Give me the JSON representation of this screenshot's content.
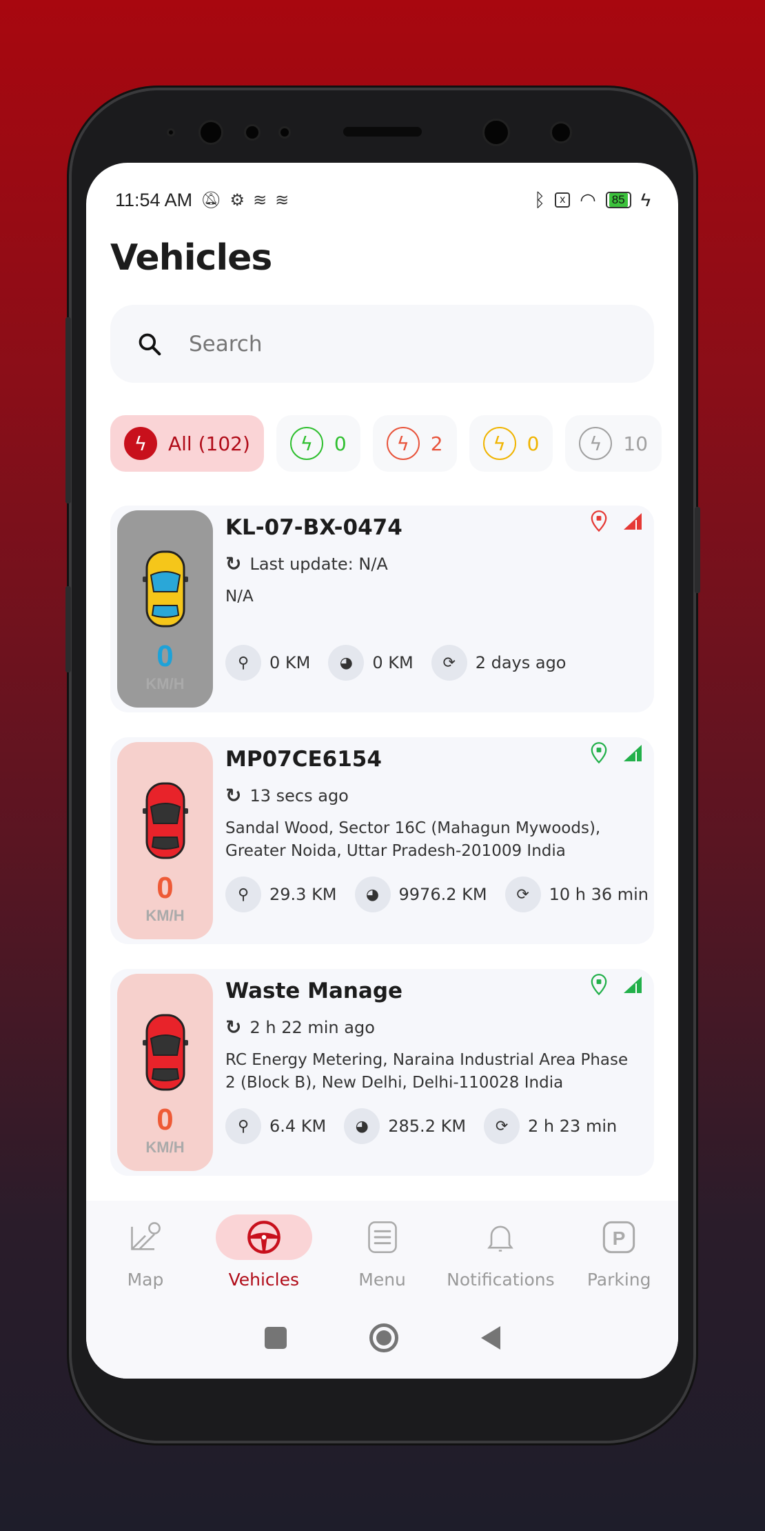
{
  "status_bar": {
    "time": "11:54 AM",
    "battery": "85"
  },
  "page": {
    "title": "Vehicles"
  },
  "search": {
    "placeholder": "Search"
  },
  "filters": [
    {
      "label": "All (102)",
      "color": "#c8101c",
      "active": true
    },
    {
      "label": "0",
      "color": "#2fbf2f"
    },
    {
      "label": "2",
      "color": "#e8533a"
    },
    {
      "label": "0",
      "color": "#f0b400"
    },
    {
      "label": "10",
      "color": "#a0a0a0"
    }
  ],
  "vehicles": [
    {
      "name": "KL-07-BX-0474",
      "update": "Last update: N/A",
      "address": "N/A",
      "speed": "0",
      "unit": "KM/H",
      "trip": "0 KM",
      "odometer": "0 KM",
      "duration": "2 days ago",
      "car_color": "yellow",
      "panel_color": "#9a9a9a",
      "speed_color": "#1ea2d8",
      "status_color": "#e53935"
    },
    {
      "name": "MP07CE6154",
      "update": "13 secs ago",
      "address": "Sandal Wood, Sector 16C (Mahagun Mywoods), Greater Noida, Uttar Pradesh-201009 India",
      "speed": "0",
      "unit": "KM/H",
      "trip": "29.3 KM",
      "odometer": "9976.2 KM",
      "duration": "10 h 36 min",
      "car_color": "red",
      "panel_color": "#f6d0cc",
      "speed_color": "#ee5a36",
      "status_color": "#22b04a"
    },
    {
      "name": "Waste Manage",
      "update": "2 h 22 min ago",
      "address": "RC Energy Metering, Naraina Industrial Area Phase 2 (Block B), New Delhi, Delhi-110028 India",
      "speed": "0",
      "unit": "KM/H",
      "trip": "6.4 KM",
      "odometer": "285.2 KM",
      "duration": "2 h 23 min",
      "car_color": "red",
      "panel_color": "#f6d0cc",
      "speed_color": "#ee5a36",
      "status_color": "#22b04a"
    }
  ],
  "nav": [
    {
      "label": "Map",
      "icon": "map-icon"
    },
    {
      "label": "Vehicles",
      "icon": "steering-wheel-icon",
      "active": true
    },
    {
      "label": "Menu",
      "icon": "menu-icon"
    },
    {
      "label": "Notifications",
      "icon": "bell-icon"
    },
    {
      "label": "Parking",
      "icon": "parking-icon"
    }
  ],
  "accent": "#b00b18"
}
